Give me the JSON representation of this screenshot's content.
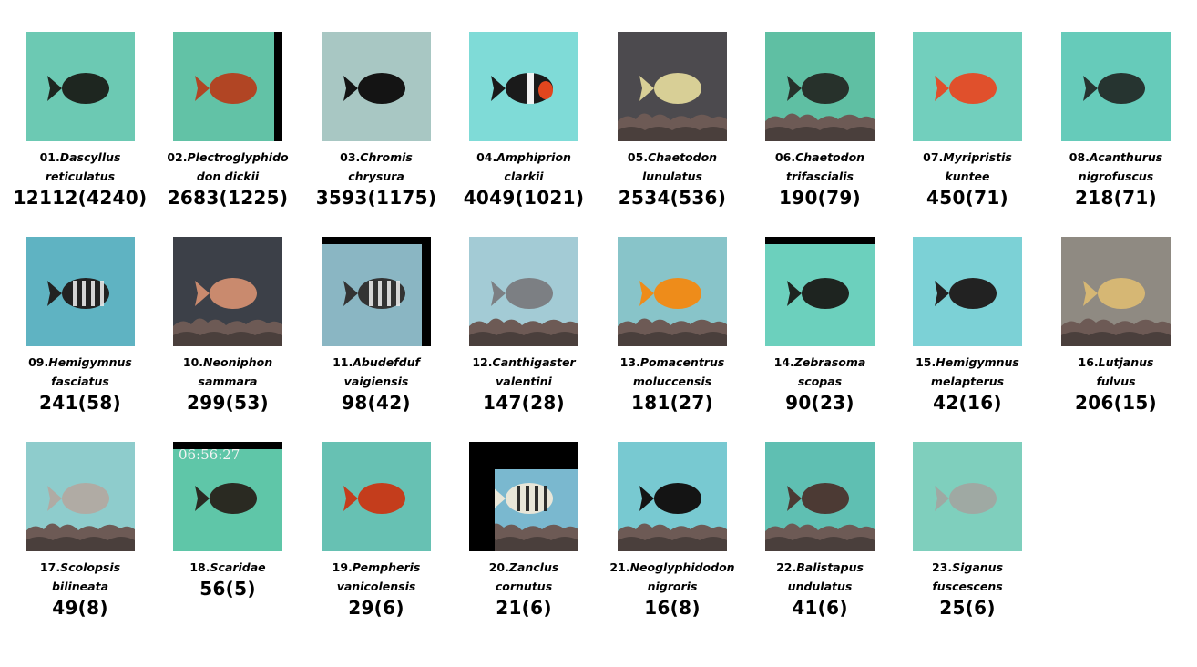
{
  "species": [
    {
      "num": "01",
      "line1": "Dascyllus",
      "line2": "reticulatus",
      "count": "12112(4240)",
      "bg": "#6cc9b3",
      "fish": "#1e2620",
      "kind": "plain",
      "frame": "none"
    },
    {
      "num": "02",
      "line1": "Plectroglyphido",
      "line2": "don dickii",
      "count": "2683(1225)",
      "bg": "#62c2a6",
      "fish": "#b14524",
      "kind": "plain",
      "frame": "right"
    },
    {
      "num": "03",
      "line1": "Chromis",
      "line2": "chrysura",
      "count": "3593(1175)",
      "bg": "#a8c7c3",
      "fish": "#141414",
      "kind": "plain",
      "frame": "none"
    },
    {
      "num": "04",
      "line1": "Amphiprion",
      "line2": "clarkii",
      "count": "4049(1021)",
      "bg": "#7fdbd7",
      "fish": "#1a1a1a",
      "kind": "clown",
      "frame": "none"
    },
    {
      "num": "05",
      "line1": "Chaetodon",
      "line2": "lunulatus",
      "count": "2534(536)",
      "bg": "#4c4a4e",
      "fish": "#d8cf96",
      "kind": "reef-disc",
      "frame": "none"
    },
    {
      "num": "06",
      "line1": "Chaetodon",
      "line2": "trifascialis",
      "count": "190(79)",
      "bg": "#5fbfa3",
      "fish": "#27312b",
      "kind": "reef",
      "frame": "none"
    },
    {
      "num": "07",
      "line1": "Myripristis",
      "line2": "kuntee",
      "count": "450(71)",
      "bg": "#72cfbd",
      "fish": "#e0502c",
      "kind": "plain",
      "frame": "none"
    },
    {
      "num": "08",
      "line1": "Acanthurus",
      "line2": "nigrofuscus",
      "count": "218(71)",
      "bg": "#66cbba",
      "fish": "#263430",
      "kind": "plain",
      "frame": "none"
    },
    {
      "num": "09",
      "line1": "Hemigymnus",
      "line2": "fasciatus",
      "count": "241(58)",
      "bg": "#5fb3c2",
      "fish": "#222222",
      "kind": "striped",
      "frame": "none"
    },
    {
      "num": "10",
      "line1": "Neoniphon",
      "line2": "sammara",
      "count": "299(53)",
      "bg": "#3c4048",
      "fish": "#c98a6e",
      "kind": "reef",
      "frame": "none"
    },
    {
      "num": "11",
      "line1": "Abudefduf",
      "line2": "vaigiensis",
      "count": "98(42)",
      "bg": "#8ab6c3",
      "fish": "#333333",
      "kind": "striped",
      "frame": "topright"
    },
    {
      "num": "12",
      "line1": "Canthigaster",
      "line2": "valentini",
      "count": "147(28)",
      "bg": "#a3cbd5",
      "fish": "#7c7f83",
      "kind": "reef",
      "frame": "none"
    },
    {
      "num": "13",
      "line1": "Pomacentrus",
      "line2": "moluccensis",
      "count": "181(27)",
      "bg": "#88c4c9",
      "fish": "#ee8c1a",
      "kind": "reef",
      "frame": "none"
    },
    {
      "num": "14",
      "line1": "Zebrasoma",
      "line2": "scopas",
      "count": "90(23)",
      "bg": "#6cd0bd",
      "fish": "#1e2420",
      "kind": "plain",
      "frame": "top"
    },
    {
      "num": "15",
      "line1": "Hemigymnus",
      "line2": "melapterus",
      "count": "42(16)",
      "bg": "#7cd1d6",
      "fish": "#222222",
      "kind": "plain",
      "frame": "none"
    },
    {
      "num": "16",
      "line1": "Lutjanus",
      "line2": "fulvus",
      "count": "206(15)",
      "bg": "#8f8a82",
      "fish": "#d6b774",
      "kind": "reef",
      "frame": "none"
    },
    {
      "num": "17",
      "line1": "Scolopsis",
      "line2": "bilineata",
      "count": "49(8)",
      "bg": "#8ecccc",
      "fish": "#b0aba4",
      "kind": "reef",
      "frame": "none"
    },
    {
      "num": "18",
      "line1": "Scaridae",
      "line2": "",
      "count": "56(5)",
      "bg": "#5fc6a8",
      "fish": "#2a2a22",
      "kind": "plain",
      "frame": "top",
      "stamp": "06:56:27"
    },
    {
      "num": "19",
      "line1": "Pempheris",
      "line2": "vanicolensis",
      "count": "29(6)",
      "bg": "#67c1b3",
      "fish": "#c43d1c",
      "kind": "plain",
      "frame": "none"
    },
    {
      "num": "20",
      "line1": "Zanclus",
      "line2": "cornutus",
      "count": "21(6)",
      "bg": "#7ab8cf",
      "fish": "#e8e6d8",
      "kind": "reef-stripe",
      "frame": "topleft"
    },
    {
      "num": "21",
      "line1": "Neoglyphidodon",
      "line2": "nigroris",
      "count": "16(8)",
      "bg": "#78c9d1",
      "fish": "#141414",
      "kind": "reef",
      "frame": "none"
    },
    {
      "num": "22",
      "line1": "Balistapus",
      "line2": "undulatus",
      "count": "41(6)",
      "bg": "#5fbfb2",
      "fish": "#4c3a34",
      "kind": "reef",
      "frame": "none"
    },
    {
      "num": "23",
      "line1": "Siganus",
      "line2": "fuscescens",
      "count": "25(6)",
      "bg": "#7fcfbd",
      "fish": "#9fa9a3",
      "kind": "plain",
      "frame": "none"
    }
  ]
}
